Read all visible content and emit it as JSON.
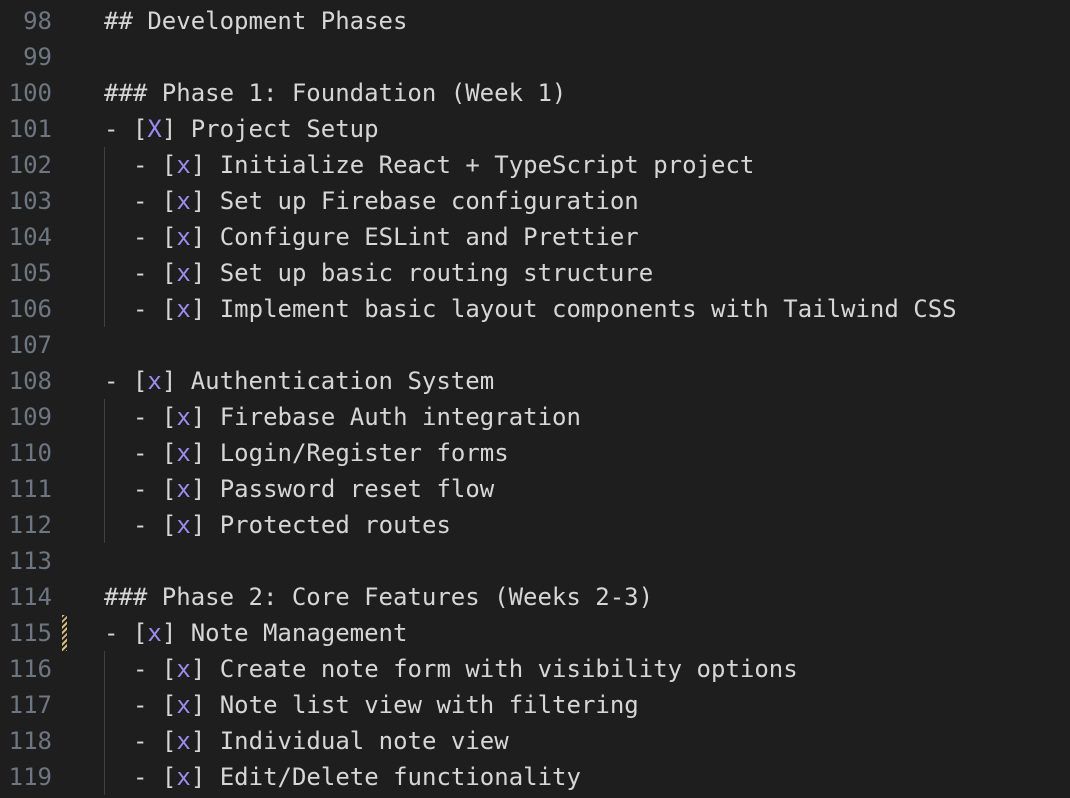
{
  "editor": {
    "lines": [
      {
        "num": "98",
        "kind": "heading",
        "text": "## Development Phases"
      },
      {
        "num": "99",
        "kind": "blank"
      },
      {
        "num": "100",
        "kind": "heading",
        "text": "### Phase 1: Foundation (Week 1)"
      },
      {
        "num": "101",
        "kind": "task",
        "level": 0,
        "mark": "X",
        "text": "Project Setup"
      },
      {
        "num": "102",
        "kind": "task",
        "level": 1,
        "mark": "x",
        "text": "Initialize React + TypeScript project"
      },
      {
        "num": "103",
        "kind": "task",
        "level": 1,
        "mark": "x",
        "text": "Set up Firebase configuration"
      },
      {
        "num": "104",
        "kind": "task",
        "level": 1,
        "mark": "x",
        "text": "Configure ESLint and Prettier"
      },
      {
        "num": "105",
        "kind": "task",
        "level": 1,
        "mark": "x",
        "text": "Set up basic routing structure"
      },
      {
        "num": "106",
        "kind": "task",
        "level": 1,
        "mark": "x",
        "text": "Implement basic layout components with Tailwind CSS"
      },
      {
        "num": "107",
        "kind": "blank"
      },
      {
        "num": "108",
        "kind": "task",
        "level": 0,
        "mark": "x",
        "text": "Authentication System"
      },
      {
        "num": "109",
        "kind": "task",
        "level": 1,
        "mark": "x",
        "text": "Firebase Auth integration"
      },
      {
        "num": "110",
        "kind": "task",
        "level": 1,
        "mark": "x",
        "text": "Login/Register forms"
      },
      {
        "num": "111",
        "kind": "task",
        "level": 1,
        "mark": "x",
        "text": "Password reset flow"
      },
      {
        "num": "112",
        "kind": "task",
        "level": 1,
        "mark": "x",
        "text": "Protected routes"
      },
      {
        "num": "113",
        "kind": "blank"
      },
      {
        "num": "114",
        "kind": "heading",
        "text": "### Phase 2: Core Features (Weeks 2-3)"
      },
      {
        "num": "115",
        "kind": "task",
        "level": 0,
        "mark": "x",
        "text": "Note Management",
        "modified": true
      },
      {
        "num": "116",
        "kind": "task",
        "level": 1,
        "mark": "x",
        "text": "Create note form with visibility options"
      },
      {
        "num": "117",
        "kind": "task",
        "level": 1,
        "mark": "x",
        "text": "Note list view with filtering"
      },
      {
        "num": "118",
        "kind": "task",
        "level": 1,
        "mark": "x",
        "text": "Individual note view"
      },
      {
        "num": "119",
        "kind": "task",
        "level": 1,
        "mark": "x",
        "text": "Edit/Delete functionality"
      }
    ]
  }
}
